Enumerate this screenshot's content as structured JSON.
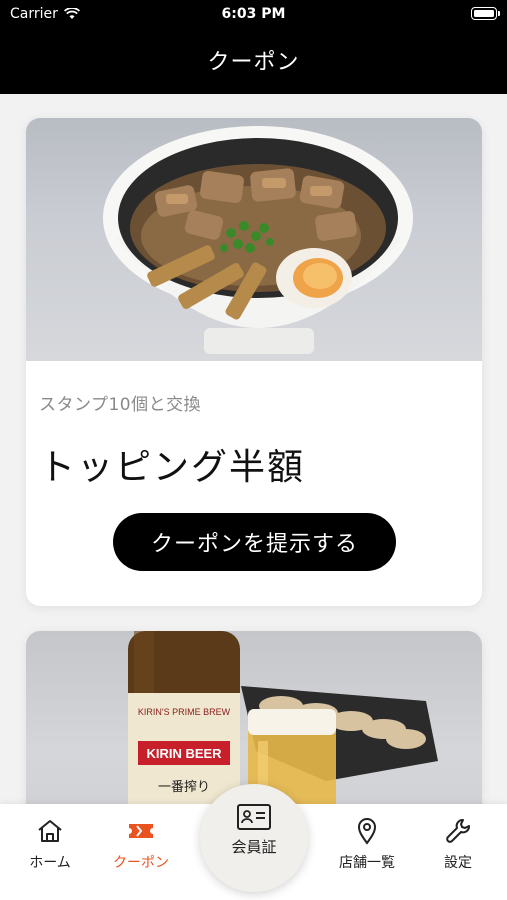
{
  "status": {
    "carrier": "Carrier",
    "time": "6:03 PM"
  },
  "nav": {
    "title": "クーポン"
  },
  "coupons": [
    {
      "condition": "スタンプ10個と交換",
      "title": "トッピング半額",
      "button": "クーポンを提示する",
      "image_icon": "ramen-photo"
    },
    {
      "image_icon": "beer-gyoza-photo",
      "beer_label_top": "KIRIN'S PRIME BREW",
      "beer_label_brand": "KIRIN BEER",
      "beer_label_sub": "一番搾り"
    }
  ],
  "tabs": {
    "home": "ホーム",
    "coupon": "クーポン",
    "member": "会員証",
    "stores": "店舗一覧",
    "settings": "設定"
  },
  "colors": {
    "accent": "#e8531f",
    "bar": "#000000"
  }
}
